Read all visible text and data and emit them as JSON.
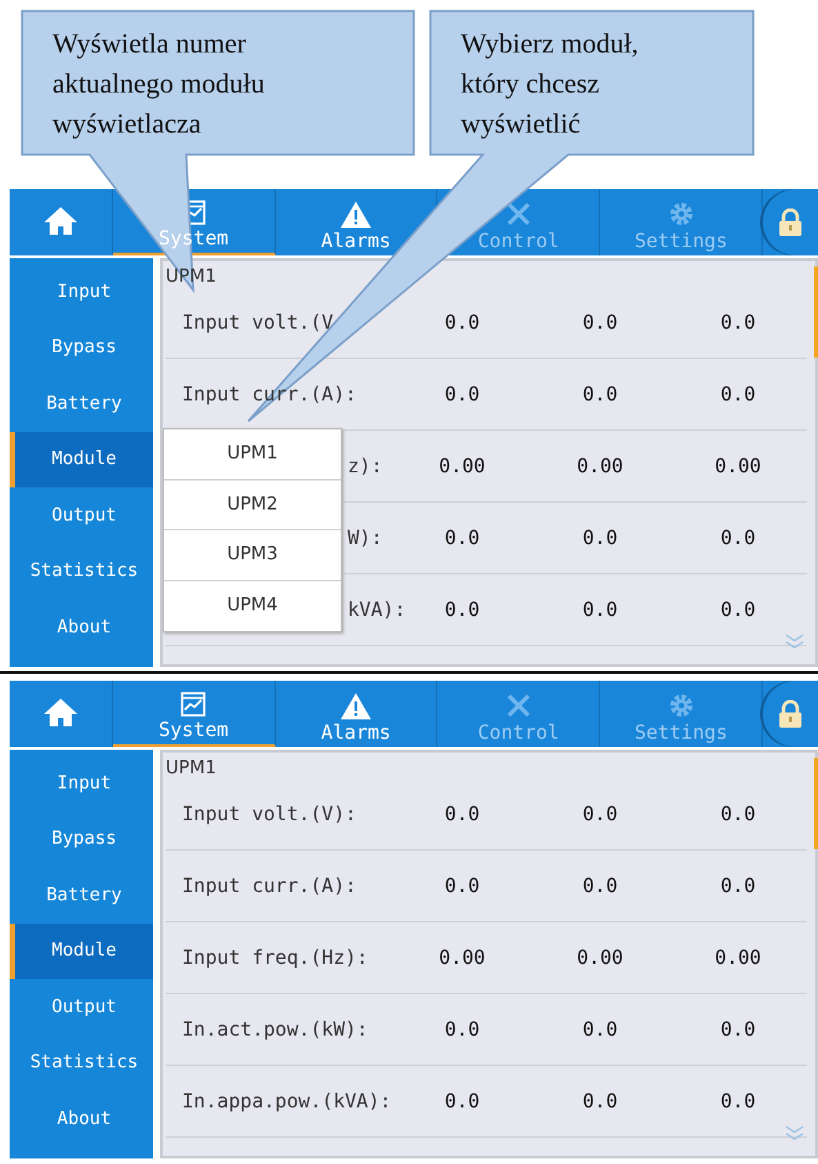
{
  "callouts": [
    {
      "lines": [
        "Wyświetla numer",
        "aktualnego modułu",
        "wyświetlacza"
      ]
    },
    {
      "lines": [
        "Wybierz moduł,",
        "który chcesz",
        "wyświetlić"
      ]
    }
  ],
  "screens": [
    {
      "tabs": [
        {
          "kind": "home",
          "selected": false,
          "disabled": false
        },
        {
          "kind": "system",
          "label": "System",
          "selected": true,
          "disabled": false
        },
        {
          "kind": "alarms",
          "label": "Alarms",
          "selected": false,
          "disabled": false
        },
        {
          "kind": "control",
          "label": "Control",
          "selected": false,
          "disabled": true
        },
        {
          "kind": "settings",
          "label": "Settings",
          "selected": false,
          "disabled": true
        }
      ],
      "sidebar": [
        {
          "label": "Input",
          "selected": false
        },
        {
          "label": "Bypass",
          "selected": false
        },
        {
          "label": "Battery",
          "selected": false
        },
        {
          "label": "Module",
          "selected": true
        },
        {
          "label": "Output",
          "selected": false
        },
        {
          "label": "Statistics",
          "selected": false
        },
        {
          "label": "About",
          "selected": false
        }
      ],
      "module_title": "UPM1",
      "rows": [
        {
          "label": "Input volt.(V",
          "values": [
            "0.0",
            "0.0",
            "0.0"
          ]
        },
        {
          "label": "Input curr.(A):",
          "values": [
            "0.0",
            "0.0",
            "0.0"
          ]
        },
        {
          "label": "z):",
          "values": [
            "0.00",
            "0.00",
            "0.00"
          ]
        },
        {
          "label": "W):",
          "values": [
            "0.0",
            "0.0",
            "0.0"
          ]
        },
        {
          "label": "kVA):",
          "values": [
            "0.0",
            "0.0",
            "0.0"
          ]
        }
      ],
      "dropdown": {
        "items": [
          "UPM1",
          "UPM2",
          "UPM3",
          "UPM4"
        ]
      }
    },
    {
      "tabs": [
        {
          "kind": "home",
          "selected": false,
          "disabled": false
        },
        {
          "kind": "system",
          "label": "System",
          "selected": true,
          "disabled": false
        },
        {
          "kind": "alarms",
          "label": "Alarms",
          "selected": false,
          "disabled": false
        },
        {
          "kind": "control",
          "label": "Control",
          "selected": false,
          "disabled": true
        },
        {
          "kind": "settings",
          "label": "Settings",
          "selected": false,
          "disabled": true
        }
      ],
      "sidebar": [
        {
          "label": "Input",
          "selected": false
        },
        {
          "label": "Bypass",
          "selected": false
        },
        {
          "label": "Battery",
          "selected": false
        },
        {
          "label": "Module",
          "selected": true
        },
        {
          "label": "Output",
          "selected": false
        },
        {
          "label": "Statistics",
          "selected": false
        },
        {
          "label": "About",
          "selected": false
        }
      ],
      "module_title": "UPM1",
      "rows": [
        {
          "label": "Input volt.(V):",
          "values": [
            "0.0",
            "0.0",
            "0.0"
          ]
        },
        {
          "label": "Input curr.(A):",
          "values": [
            "0.0",
            "0.0",
            "0.0"
          ]
        },
        {
          "label": "Input freq.(Hz):",
          "values": [
            "0.00",
            "0.00",
            "0.00"
          ]
        },
        {
          "label": "In.act.pow.(kW):",
          "values": [
            "0.0",
            "0.0",
            "0.0"
          ]
        },
        {
          "label": "In.appa.pow.(kVA):",
          "values": [
            "0.0",
            "0.0",
            "0.0"
          ]
        }
      ]
    }
  ]
}
